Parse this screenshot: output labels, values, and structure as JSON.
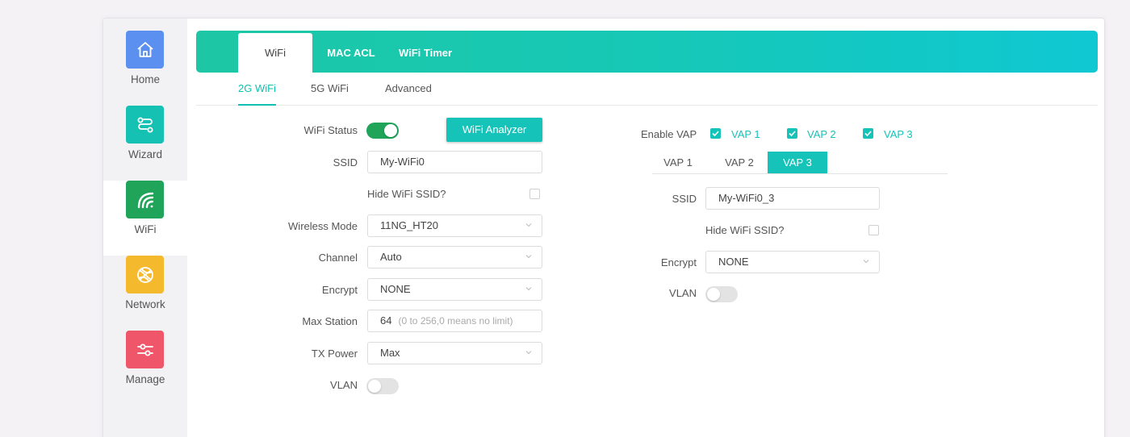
{
  "sidebar": {
    "items": [
      {
        "label": "Home",
        "icon": "home-icon",
        "color": "#5b8ff0"
      },
      {
        "label": "Wizard",
        "icon": "wizard-icon",
        "color": "#15c1b3"
      },
      {
        "label": "WiFi",
        "icon": "wifi-icon",
        "color": "#1fa45a"
      },
      {
        "label": "Network",
        "icon": "network-icon",
        "color": "#f5b92e"
      },
      {
        "label": "Manage",
        "icon": "manage-icon",
        "color": "#f0566a"
      }
    ]
  },
  "top_tabs": [
    "WiFi",
    "MAC ACL",
    "WiFi Timer"
  ],
  "sub_tabs": [
    "2G WiFi",
    "5G WiFi",
    "Advanced"
  ],
  "form": {
    "wifi_status_label": "WiFi Status",
    "analyzer_button": "WiFi Analyzer",
    "ssid_label": "SSID",
    "ssid_value": "My-WiFi0",
    "hide_ssid_label": "Hide WiFi SSID?",
    "wireless_mode_label": "Wireless Mode",
    "wireless_mode_value": "11NG_HT20",
    "channel_label": "Channel",
    "channel_value": "Auto",
    "encrypt_label": "Encrypt",
    "encrypt_value": "NONE",
    "max_station_label": "Max Station",
    "max_station_value": "64",
    "max_station_hint": "(0 to 256,0 means no limit)",
    "tx_power_label": "TX Power",
    "tx_power_value": "Max",
    "vlan_label": "VLAN"
  },
  "vap": {
    "enable_label": "Enable VAP",
    "options": [
      "VAP 1",
      "VAP 2",
      "VAP 3"
    ],
    "tabs": [
      "VAP 1",
      "VAP 2",
      "VAP 3"
    ],
    "ssid_label": "SSID",
    "ssid_value": "My-WiFi0_3",
    "hide_ssid_label": "Hide WiFi SSID?",
    "encrypt_label": "Encrypt",
    "encrypt_value": "NONE",
    "vlan_label": "VLAN"
  },
  "colors": {
    "accent": "#16c3b9",
    "toggle_on": "#1fa45a"
  }
}
